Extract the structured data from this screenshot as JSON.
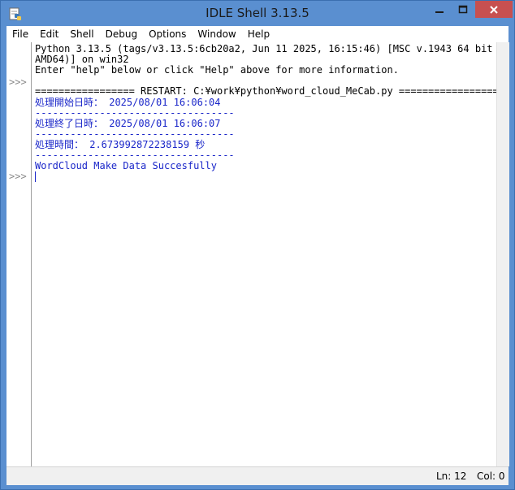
{
  "window": {
    "title": "IDLE Shell 3.13.5",
    "minimize_glyph": "—",
    "maximize_glyph": "□",
    "close_glyph": "✕"
  },
  "menu": {
    "items": [
      "File",
      "Edit",
      "Shell",
      "Debug",
      "Options",
      "Window",
      "Help"
    ]
  },
  "shell": {
    "prompt": ">>>",
    "banner_line1": "Python 3.13.5 (tags/v3.13.5:6cb20a2, Jun 11 2025, 16:15:46) [MSC v.1943 64 bit (",
    "banner_line2": "AMD64)] on win32",
    "banner_line3": "Enter \"help\" below or click \"Help\" above for more information.",
    "restart_line": "================= RESTART: C:¥work¥python¥word_cloud_MeCab.py =================",
    "output": [
      "処理開始日時： 2025/08/01 16:06:04",
      "----------------------------------",
      "処理終了日時： 2025/08/01 16:06:07",
      "----------------------------------",
      "処理時間： 2.673992872238159 秒",
      "----------------------------------",
      "WordCloud Make Data Succesfully"
    ]
  },
  "status": {
    "line": "Ln: 12",
    "column": "Col: 0"
  },
  "colors": {
    "titlebar": "#5a8fd0",
    "close_button": "#c75050",
    "output_text": "#1a26c9",
    "prompt_text": "#8a8a8a"
  }
}
